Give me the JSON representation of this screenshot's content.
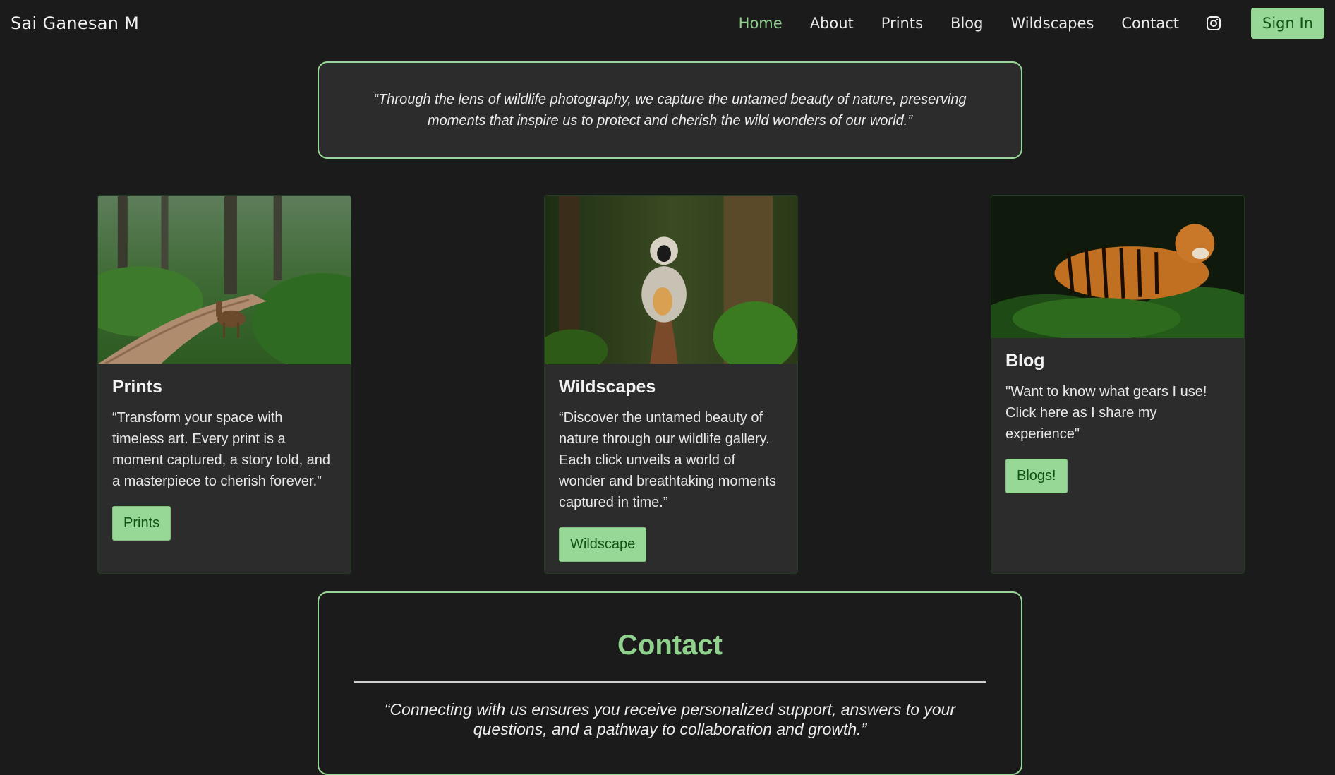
{
  "brand": "Sai Ganesan M",
  "nav": {
    "links": [
      "Home",
      "About",
      "Prints",
      "Blog",
      "Wildscapes",
      "Contact"
    ],
    "active": "Home",
    "icon": "instagram-icon",
    "signin_label": "Sign In"
  },
  "quote": "“Through the lens of wildlife photography, we capture the untamed beauty of nature, preserving moments that inspire us to protect and cherish the wild wonders of our world.”",
  "cards": [
    {
      "title": "Prints",
      "text": "“Transform your space with timeless art. Every print is a moment captured, a story told, and a masterpiece to cherish forever.”",
      "button": "Prints",
      "image": "deer-on-forest-path-photo"
    },
    {
      "title": "Wildscapes",
      "text": "“Discover the untamed beauty of nature through our wildlife gallery. Each click unveils a world of wonder and breathtaking moments captured in time.”",
      "button": "Wildscape",
      "image": "langur-monkey-photo"
    },
    {
      "title": "Blog",
      "text": "\"Want to know what gears I use! Click here as I share my experience\"",
      "button": "Blogs!",
      "image": "tiger-in-foliage-photo"
    }
  ],
  "contact": {
    "title": "Contact",
    "quote": "“Connecting with us ensures you receive personalized support, answers to your questions, and a pathway to collaboration and growth.”"
  },
  "colors": {
    "accent": "#98d896",
    "accent_text": "#8fd18d",
    "background": "#1b1b1b",
    "card": "#2c2c2c"
  }
}
